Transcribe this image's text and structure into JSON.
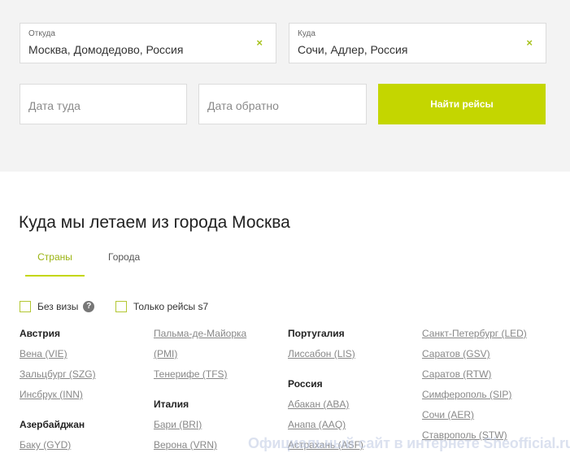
{
  "search": {
    "from": {
      "label": "Откуда",
      "value": "Москва, Домодедово, Россия",
      "clear": "×"
    },
    "to": {
      "label": "Куда",
      "value": "Сочи, Адлер, Россия",
      "clear": "×"
    },
    "date_there_placeholder": "Дата туда",
    "date_back_placeholder": "Дата обратно",
    "button_label": "Найти рейсы"
  },
  "colors": {
    "accent": "#c4d600",
    "background": "#f3f3f3"
  },
  "destinations": {
    "title": "Куда мы летаем из города Москва",
    "tabs": [
      {
        "label": "Страны",
        "active": true
      },
      {
        "label": "Города",
        "active": false
      }
    ],
    "filters": {
      "no_visa": "Без визы",
      "help": "?",
      "s7_only": "Только рейсы s7"
    },
    "columns": [
      [
        {
          "type": "group",
          "text": "Австрия"
        },
        {
          "type": "city",
          "text": "Вена (VIE)"
        },
        {
          "type": "city",
          "text": "Зальцбург (SZG)"
        },
        {
          "type": "city",
          "text": "Инсбрук (INN)"
        },
        {
          "type": "gap"
        },
        {
          "type": "group",
          "text": "Азербайджан"
        },
        {
          "type": "city",
          "text": "Баку (GYD)"
        }
      ],
      [
        {
          "type": "city",
          "text": "Пальма-де-Майорка"
        },
        {
          "type": "city",
          "text": "(PMI)"
        },
        {
          "type": "city",
          "text": "Тенерифе (TFS)"
        },
        {
          "type": "gap"
        },
        {
          "type": "group",
          "text": "Италия"
        },
        {
          "type": "city",
          "text": "Бари (BRI)"
        },
        {
          "type": "city",
          "text": "Верона (VRN)"
        }
      ],
      [
        {
          "type": "group",
          "text": "Португалия"
        },
        {
          "type": "city",
          "text": "Лиссабон (LIS)"
        },
        {
          "type": "gap"
        },
        {
          "type": "group",
          "text": "Россия"
        },
        {
          "type": "city",
          "text": "Абакан (ABA)"
        },
        {
          "type": "city",
          "text": "Анапа (AAQ)"
        },
        {
          "type": "city",
          "text": "Астрахань (ASF)"
        }
      ],
      [
        {
          "type": "city",
          "text": "Санкт-Петербург (LED)"
        },
        {
          "type": "city",
          "text": "Саратов (GSV)"
        },
        {
          "type": "city",
          "text": "Саратов (RTW)"
        },
        {
          "type": "city",
          "text": "Симферополь (SIP)"
        },
        {
          "type": "city",
          "text": "Сочи (AER)"
        },
        {
          "type": "city",
          "text": "Ставрополь (STW)"
        }
      ]
    ]
  },
  "watermark": "Официальный сайт в интернете Sheofficial.ru"
}
